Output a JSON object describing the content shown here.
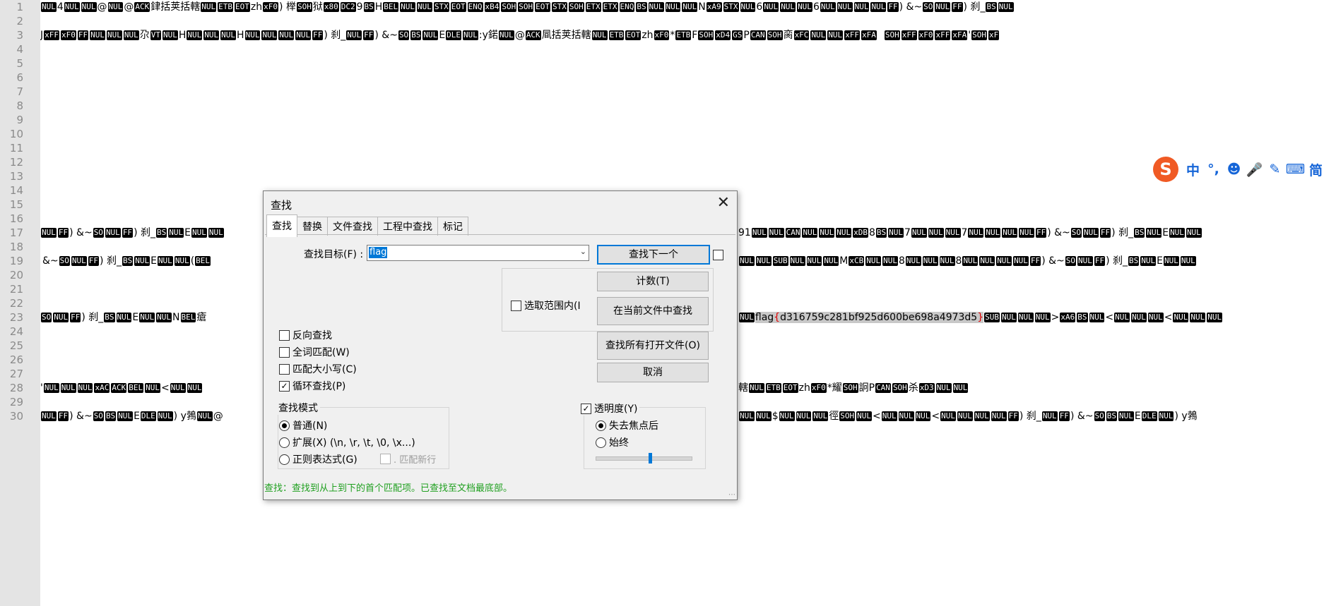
{
  "editor": {
    "line_numbers": [
      "1",
      "2",
      "3",
      "4",
      "5",
      "6",
      "7",
      "8",
      "9",
      "10",
      "11",
      "12",
      "13",
      "14",
      "15",
      "16",
      "17",
      "18",
      "19",
      "20",
      "21",
      "22",
      "23",
      "24",
      "25",
      "26",
      "27",
      "28",
      "29",
      "30"
    ],
    "lines": {
      "l1": [
        {
          "c": "NUL"
        },
        {
          "t": "4"
        },
        {
          "c": "NUL"
        },
        {
          "c": "NUL"
        },
        {
          "t": "@"
        },
        {
          "c": "NUL"
        },
        {
          "t": "@"
        },
        {
          "c": "ACK"
        },
        {
          "t": "銉括荚括轄"
        },
        {
          "c": "NUL"
        },
        {
          "c": "ETB"
        },
        {
          "c": "EOT"
        },
        {
          "t": "zh"
        },
        {
          "c": "xF0"
        },
        {
          "t": ") 榉"
        },
        {
          "c": "SOH"
        },
        {
          "t": "狱"
        },
        {
          "c": "x80"
        },
        {
          "c": "DC2"
        },
        {
          "t": "9"
        },
        {
          "c": "BS"
        },
        {
          "t": "H"
        },
        {
          "c": "BEL"
        },
        {
          "c": "NUL"
        },
        {
          "c": "NUL"
        },
        {
          "c": "STX"
        },
        {
          "c": "EOT"
        },
        {
          "c": "ENQ"
        },
        {
          "c": "xB4"
        },
        {
          "c": "SOH"
        },
        {
          "c": "SOH"
        },
        {
          "c": "EOT"
        },
        {
          "c": "STX"
        },
        {
          "c": "SOH"
        },
        {
          "c": "ETX"
        },
        {
          "c": "ETX"
        },
        {
          "c": "ENQ"
        },
        {
          "c": "BS"
        },
        {
          "c": "NUL"
        },
        {
          "c": "NUL"
        },
        {
          "c": "NUL"
        },
        {
          "t": "N"
        },
        {
          "c": "xA9"
        },
        {
          "c": "STX"
        },
        {
          "c": "NUL"
        },
        {
          "t": "6"
        },
        {
          "c": "NUL"
        },
        {
          "c": "NUL"
        },
        {
          "c": "NUL"
        },
        {
          "t": "6"
        },
        {
          "c": "NUL"
        },
        {
          "c": "NUL"
        },
        {
          "c": "NUL"
        },
        {
          "c": "NUL"
        },
        {
          "c": "FF"
        },
        {
          "t": ") &~"
        },
        {
          "c": "SO"
        },
        {
          "c": "NUL"
        },
        {
          "c": "FF"
        },
        {
          "t": ") 刹_"
        },
        {
          "c": "BS"
        },
        {
          "c": "NUL"
        }
      ],
      "l3": [
        {
          "t": "J"
        },
        {
          "c": "xFF"
        },
        {
          "c": "xF0"
        },
        {
          "c": "FF"
        },
        {
          "c": "NUL"
        },
        {
          "c": "NUL"
        },
        {
          "c": "NUL"
        },
        {
          "t": "尕"
        },
        {
          "c": "VT"
        },
        {
          "c": "NUL"
        },
        {
          "t": "H"
        },
        {
          "c": "NUL"
        },
        {
          "c": "NUL"
        },
        {
          "c": "NUL"
        },
        {
          "t": "H"
        },
        {
          "c": "NUL"
        },
        {
          "c": "NUL"
        },
        {
          "c": "NUL"
        },
        {
          "c": "NUL"
        },
        {
          "c": "FF"
        },
        {
          "t": ") 刹_"
        },
        {
          "c": "NUL"
        },
        {
          "c": "FF"
        },
        {
          "t": ") &~"
        },
        {
          "c": "SO"
        },
        {
          "c": "BS"
        },
        {
          "c": "NUL"
        },
        {
          "t": "E"
        },
        {
          "c": "DLE"
        },
        {
          "c": "NUL"
        },
        {
          "t": ":y鍩"
        },
        {
          "c": "NUL"
        },
        {
          "t": "@"
        },
        {
          "c": "ACK"
        },
        {
          "t": "凬括荚括轄"
        },
        {
          "c": "NUL"
        },
        {
          "c": "ETB"
        },
        {
          "c": "EOT"
        },
        {
          "t": "zh"
        },
        {
          "c": "xF0"
        },
        {
          "t": "*"
        },
        {
          "c": "ETB"
        },
        {
          "t": "F"
        },
        {
          "c": "SOH"
        },
        {
          "c": "xD4"
        },
        {
          "c": "GS"
        },
        {
          "t": "P"
        },
        {
          "c": "CAN"
        },
        {
          "c": "SOH"
        },
        {
          "t": "脔"
        },
        {
          "c": "xFC"
        },
        {
          "c": "NUL"
        },
        {
          "c": "NUL"
        },
        {
          "c": "xFF"
        },
        {
          "c": "xFA"
        },
        {
          "t": "  "
        },
        {
          "c": "SOH"
        },
        {
          "c": "xFF"
        },
        {
          "c": "xF0"
        },
        {
          "c": "xFF"
        },
        {
          "c": "xFA"
        },
        {
          "t": "'"
        },
        {
          "c": "SOH"
        },
        {
          "c": "xF"
        }
      ],
      "l17_left": [
        {
          "c": "NUL"
        },
        {
          "c": "FF"
        },
        {
          "t": ") &~"
        },
        {
          "c": "SO"
        },
        {
          "c": "NUL"
        },
        {
          "c": "FF"
        },
        {
          "t": ") 刹_"
        },
        {
          "c": "BS"
        },
        {
          "c": "NUL"
        },
        {
          "t": "E"
        },
        {
          "c": "NUL"
        },
        {
          "c": "NUL"
        }
      ],
      "l17_right": [
        {
          "t": "91"
        },
        {
          "c": "NUL"
        },
        {
          "c": "NUL"
        },
        {
          "c": "CAN"
        },
        {
          "c": "NUL"
        },
        {
          "c": "NUL"
        },
        {
          "c": "NUL"
        },
        {
          "c": "xDB"
        },
        {
          "t": "8"
        },
        {
          "c": "BS"
        },
        {
          "c": "NUL"
        },
        {
          "t": "7"
        },
        {
          "c": "NUL"
        },
        {
          "c": "NUL"
        },
        {
          "c": "NUL"
        },
        {
          "t": "7"
        },
        {
          "c": "NUL"
        },
        {
          "c": "NUL"
        },
        {
          "c": "NUL"
        },
        {
          "c": "NUL"
        },
        {
          "c": "FF"
        },
        {
          "t": ") &~"
        },
        {
          "c": "SO"
        },
        {
          "c": "NUL"
        },
        {
          "c": "FF"
        },
        {
          "t": ") 刹_"
        },
        {
          "c": "BS"
        },
        {
          "c": "NUL"
        },
        {
          "t": "E"
        },
        {
          "c": "NUL"
        },
        {
          "c": "NUL"
        }
      ],
      "l19_left": [
        {
          "t": "&~"
        },
        {
          "c": "SO"
        },
        {
          "c": "NUL"
        },
        {
          "c": "FF"
        },
        {
          "t": ") 刹_"
        },
        {
          "c": "BS"
        },
        {
          "c": "NUL"
        },
        {
          "t": "E"
        },
        {
          "c": "NUL"
        },
        {
          "c": "NUL"
        },
        {
          "t": "("
        },
        {
          "c": "BEL"
        }
      ],
      "l19_right": [
        {
          "c": "NUL"
        },
        {
          "c": "NUL"
        },
        {
          "c": "SUB"
        },
        {
          "c": "NUL"
        },
        {
          "c": "NUL"
        },
        {
          "c": "NUL"
        },
        {
          "t": "M"
        },
        {
          "c": "xCB"
        },
        {
          "c": "NUL"
        },
        {
          "c": "NUL"
        },
        {
          "t": "8"
        },
        {
          "c": "NUL"
        },
        {
          "c": "NUL"
        },
        {
          "c": "NUL"
        },
        {
          "t": "8"
        },
        {
          "c": "NUL"
        },
        {
          "c": "NUL"
        },
        {
          "c": "NUL"
        },
        {
          "c": "NUL"
        },
        {
          "c": "FF"
        },
        {
          "t": ") &~"
        },
        {
          "c": "SO"
        },
        {
          "c": "NUL"
        },
        {
          "c": "FF"
        },
        {
          "t": ") 刹_"
        },
        {
          "c": "BS"
        },
        {
          "c": "NUL"
        },
        {
          "t": "E"
        },
        {
          "c": "NUL"
        },
        {
          "c": "NUL"
        }
      ],
      "l23_left": [
        {
          "c": "SO"
        },
        {
          "c": "NUL"
        },
        {
          "c": "FF"
        },
        {
          "t": ") 刹_"
        },
        {
          "c": "BS"
        },
        {
          "c": "NUL"
        },
        {
          "t": "E"
        },
        {
          "c": "NUL"
        },
        {
          "c": "NUL"
        },
        {
          "t": "N"
        },
        {
          "c": "BEL"
        },
        {
          "t": "瘡"
        }
      ],
      "l23_right_pre": [
        {
          "c": "NUL"
        }
      ],
      "l23_match": "flag",
      "l23_brace_open": "{",
      "l23_flag_body": "d316759c281bf925d600be698a4973d5",
      "l23_brace_close": "}",
      "l23_right_post": [
        {
          "c": "SUB"
        },
        {
          "c": "NUL"
        },
        {
          "c": "NUL"
        },
        {
          "c": "NUL"
        },
        {
          "t": ">"
        },
        {
          "c": "xA6"
        },
        {
          "c": "BS"
        },
        {
          "c": "NUL"
        },
        {
          "t": "<"
        },
        {
          "c": "NUL"
        },
        {
          "c": "NUL"
        },
        {
          "c": "NUL"
        },
        {
          "t": "<"
        },
        {
          "c": "NUL"
        },
        {
          "c": "NUL"
        },
        {
          "c": "NUL"
        }
      ],
      "l28_left": [
        {
          "t": "'"
        },
        {
          "c": "NUL"
        },
        {
          "c": "NUL"
        },
        {
          "c": "NUL"
        },
        {
          "c": "xAC"
        },
        {
          "c": "ACK"
        },
        {
          "c": "BEL"
        },
        {
          "c": "NUL"
        },
        {
          "t": "<"
        },
        {
          "c": "NUL"
        },
        {
          "c": "NUL"
        }
      ],
      "l28_right": [
        {
          "t": "轄"
        },
        {
          "c": "NUL"
        },
        {
          "c": "ETB"
        },
        {
          "c": "EOT"
        },
        {
          "t": "zh"
        },
        {
          "c": "xF0"
        },
        {
          "t": "*耀"
        },
        {
          "c": "SOH"
        },
        {
          "t": "詗P"
        },
        {
          "c": "CAN"
        },
        {
          "c": "SOH"
        },
        {
          "t": "杀"
        },
        {
          "c": "xD3"
        },
        {
          "c": "NUL"
        },
        {
          "c": "NUL"
        }
      ],
      "l30_left": [
        {
          "c": "NUL"
        },
        {
          "c": "FF"
        },
        {
          "t": ") &~"
        },
        {
          "c": "SO"
        },
        {
          "c": "BS"
        },
        {
          "c": "NUL"
        },
        {
          "t": "E"
        },
        {
          "c": "DLE"
        },
        {
          "c": "NUL"
        },
        {
          "t": ") y鵓"
        },
        {
          "c": "NUL"
        },
        {
          "t": "@"
        }
      ],
      "l30_right": [
        {
          "c": "NUL"
        },
        {
          "c": "NUL"
        },
        {
          "t": "$"
        },
        {
          "c": "NUL"
        },
        {
          "c": "NUL"
        },
        {
          "c": "NUL"
        },
        {
          "t": "徑"
        },
        {
          "c": "SOH"
        },
        {
          "c": "NUL"
        },
        {
          "t": "<"
        },
        {
          "c": "NUL"
        },
        {
          "c": "NUL"
        },
        {
          "c": "NUL"
        },
        {
          "t": "<"
        },
        {
          "c": "NUL"
        },
        {
          "c": "NUL"
        },
        {
          "c": "NUL"
        },
        {
          "c": "NUL"
        },
        {
          "c": "FF"
        },
        {
          "t": ") 刹_"
        },
        {
          "c": "NUL"
        },
        {
          "c": "FF"
        },
        {
          "t": ") &~"
        },
        {
          "c": "SO"
        },
        {
          "c": "BS"
        },
        {
          "c": "NUL"
        },
        {
          "t": "E"
        },
        {
          "c": "DLE"
        },
        {
          "c": "NUL"
        },
        {
          "t": ") y鵓"
        }
      ]
    }
  },
  "ime": {
    "logo": "S",
    "items": [
      "中",
      "°,",
      "☻",
      "🎤",
      "✎",
      "⌨",
      "简"
    ],
    "icon_names": [
      "chinese-mode-icon",
      "punctuation-icon",
      "emoji-icon",
      "microphone-icon",
      "handwriting-icon",
      "keyboard-icon",
      "simplified-icon"
    ],
    "accent": "#1565d8",
    "logo_color": "#f05a24"
  },
  "dialog": {
    "title": "查找",
    "close": "✕",
    "tabs": [
      "查找",
      "替换",
      "文件查找",
      "工程中查找",
      "标记"
    ],
    "active_tab": 0,
    "find_label": "查找目标(F) :",
    "find_value": "flag",
    "buttons": {
      "find_next": "查找下一个",
      "count": "计数(T)",
      "find_in_current": "在当前文件中查找",
      "find_all_open": "查找所有打开文件(O)",
      "cancel": "取消"
    },
    "in_selection": "选取范围内(I",
    "options": {
      "backward": "反向查找",
      "whole_word": "全词匹配(W)",
      "match_case": "匹配大小写(C)",
      "wrap": "循环查找(P)"
    },
    "options_checked": {
      "backward": false,
      "whole_word": false,
      "match_case": false,
      "wrap": true
    },
    "mode_title": "查找模式",
    "modes": {
      "normal": "普通(N)",
      "extended": "扩展(X) (\\n, \\r, \\t, \\0, \\x...)",
      "regex": "正则表达式(G)",
      "dot_newline": ". 匹配新行"
    },
    "mode_selected": "normal",
    "transparency_label": "透明度(Y)",
    "transparency_checked": true,
    "transparency_opts": {
      "on_lose_focus": "失去焦点后",
      "always": "始终"
    },
    "transparency_selected": "on_lose_focus",
    "transparency_level": 0.57,
    "status": "查找：查找到从上到下的首个匹配项。已查找至文档最底部。",
    "status_color": "#20a020",
    "accent": "#0078d7"
  }
}
